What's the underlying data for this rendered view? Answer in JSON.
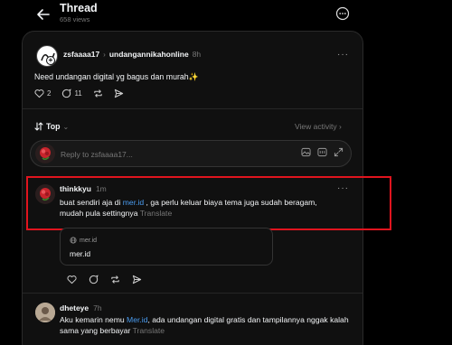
{
  "header": {
    "title": "Thread",
    "views": "658 views"
  },
  "original_post": {
    "username": "zsfaaaa17",
    "reply_to": "undangannikahonline",
    "time": "8h",
    "text": "Need undangan digital yg bagus dan murah✨",
    "likes": "2",
    "comments": "11"
  },
  "sort": {
    "label": "Top",
    "view_activity": "View activity"
  },
  "reply_box": {
    "placeholder": "Reply to zsfaaaa17..."
  },
  "replies": [
    {
      "username": "thinkkyu",
      "time": "1m",
      "text_before": "buat sendiri aja di ",
      "link": "mer.id",
      "text_after": " , ga perlu keluar biaya tema juga sudah beragam, mudah pula settingnya",
      "translate": "Translate",
      "card_domain": "mer.id",
      "card_title": "mer.id"
    },
    {
      "username": "dheteye",
      "time": "7h",
      "text_before": "Aku kemarin nemu ",
      "link": "Mer.id",
      "text_after": ", ada undangan digital gratis dan tampilannya nggak kalah sama yang berbayar",
      "translate": "Translate"
    }
  ],
  "colors": {
    "background": "#000000",
    "panel": "#101010",
    "link": "#4a9cf0",
    "highlight_border": "#e0141e"
  }
}
